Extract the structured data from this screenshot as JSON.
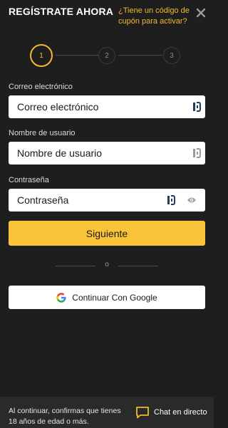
{
  "header": {
    "title": "REGÍSTRATE AHORA",
    "coupon_link": "¿Tiene un código de cupón para activar?",
    "close_icon": "close-icon"
  },
  "stepper": {
    "steps": [
      "1",
      "2",
      "3"
    ],
    "current_step": 1
  },
  "form": {
    "email": {
      "label": "Correo electrónico",
      "placeholder": "Correo electrónico"
    },
    "username": {
      "label": "Nombre de usuario",
      "placeholder": "Nombre de usuario"
    },
    "password": {
      "label": "Contraseña",
      "placeholder": "Contraseña"
    },
    "next_button": "Siguiente",
    "divider": "o",
    "google_button": "Continuar Con Google"
  },
  "footer": {
    "legal_text": "Al continuar, confirmas que tienes 18 años de edad o más.",
    "chat_label": "Chat en directo"
  },
  "colors": {
    "background": "#1e1e1e",
    "accent": "#f5b82e",
    "button": "#fac43a",
    "footer_bg": "#2a2a2a"
  }
}
